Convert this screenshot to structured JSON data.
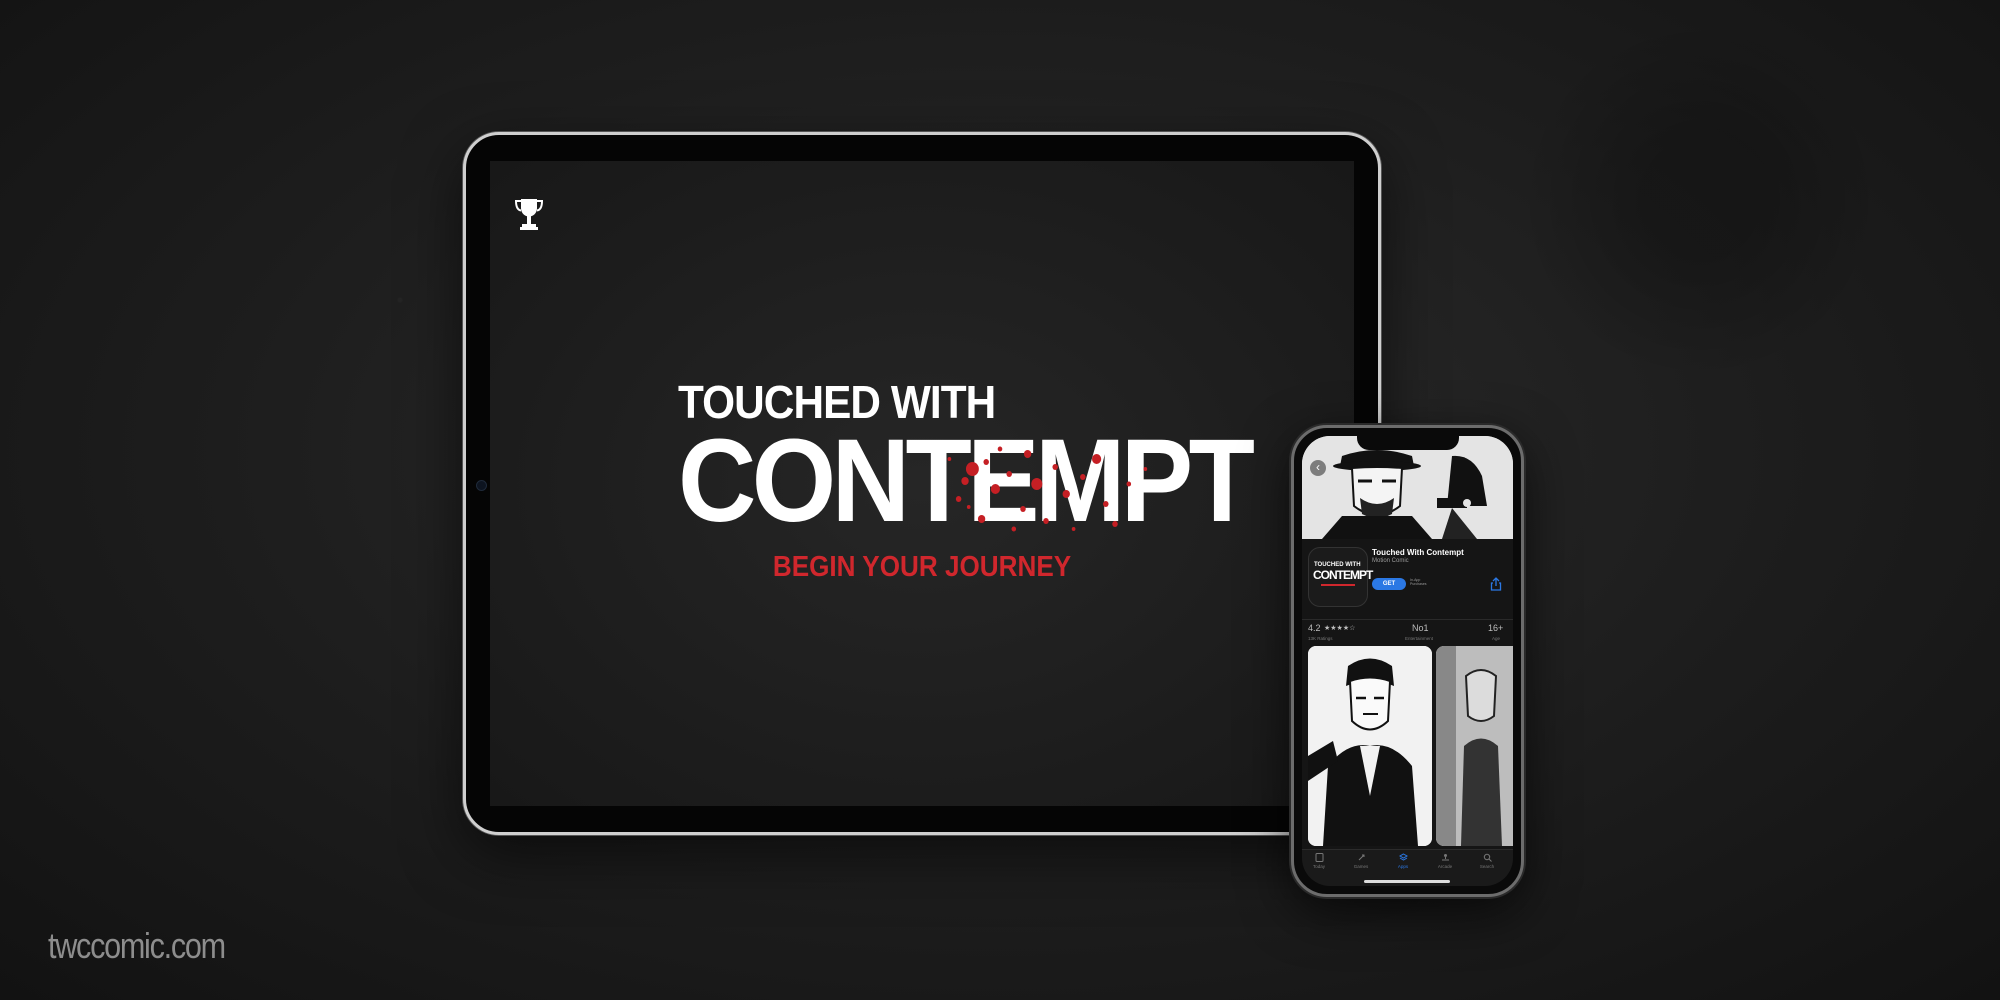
{
  "tablet": {
    "logo_line1": "TOUCHED WITH",
    "logo_line2": "CONTEMPT",
    "cta": "BEGIN YOUR JOURNEY",
    "trophy_icon": "trophy-icon"
  },
  "phone": {
    "app_store": {
      "app_name": "Touched With Contempt",
      "app_subtitle": "Motion Comic",
      "icon_line1": "TOUCHED WITH",
      "icon_line2": "CONTEMPT",
      "get_label": "GET",
      "iap_note": "In-App Purchases",
      "rating_value": "4.2",
      "rating_stars": "★★★★☆",
      "ratings_count": "13K Ratings",
      "rank_value": "No1",
      "rank_label": "Entertainment",
      "age_value": "16+",
      "age_label": "Age"
    },
    "tabs": [
      {
        "label": "Today"
      },
      {
        "label": "Games"
      },
      {
        "label": "Apps"
      },
      {
        "label": "Arcade"
      },
      {
        "label": "Search"
      }
    ]
  },
  "footer": {
    "site": "twccomic.com"
  },
  "colors": {
    "accent_red": "#d0272d",
    "ios_blue": "#2b78e4",
    "background": "#1d1d1d"
  }
}
